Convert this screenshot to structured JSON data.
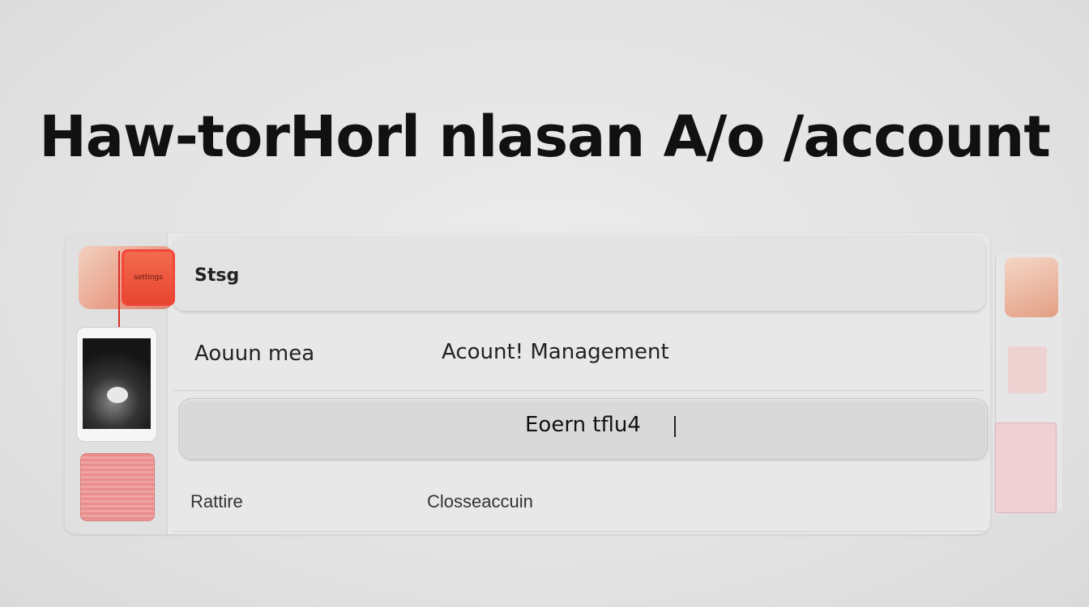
{
  "headline": "Haw-torHorl nlasan A/o /account",
  "panel": {
    "settings_row": {
      "label": "Stsg",
      "icon_text": "settings"
    },
    "account_row": {
      "left_label": "Aouun mea",
      "right_label": "Acount! Management"
    },
    "button": {
      "label": "Eoern  tflu4"
    },
    "bottom_row": {
      "left_label": "Rattire",
      "right_label": "Closseaccuin"
    }
  },
  "icons": {
    "settings": "settings-icon",
    "phone": "phone-icon",
    "card": "card-icon",
    "right_top": "profile-icon",
    "right_mid": "image-icon",
    "right_bottom": "document-icon"
  },
  "colors": {
    "accent_red": "#e9452e",
    "accent_peach": "#e9a08a",
    "card_pink": "#e98d8d"
  }
}
